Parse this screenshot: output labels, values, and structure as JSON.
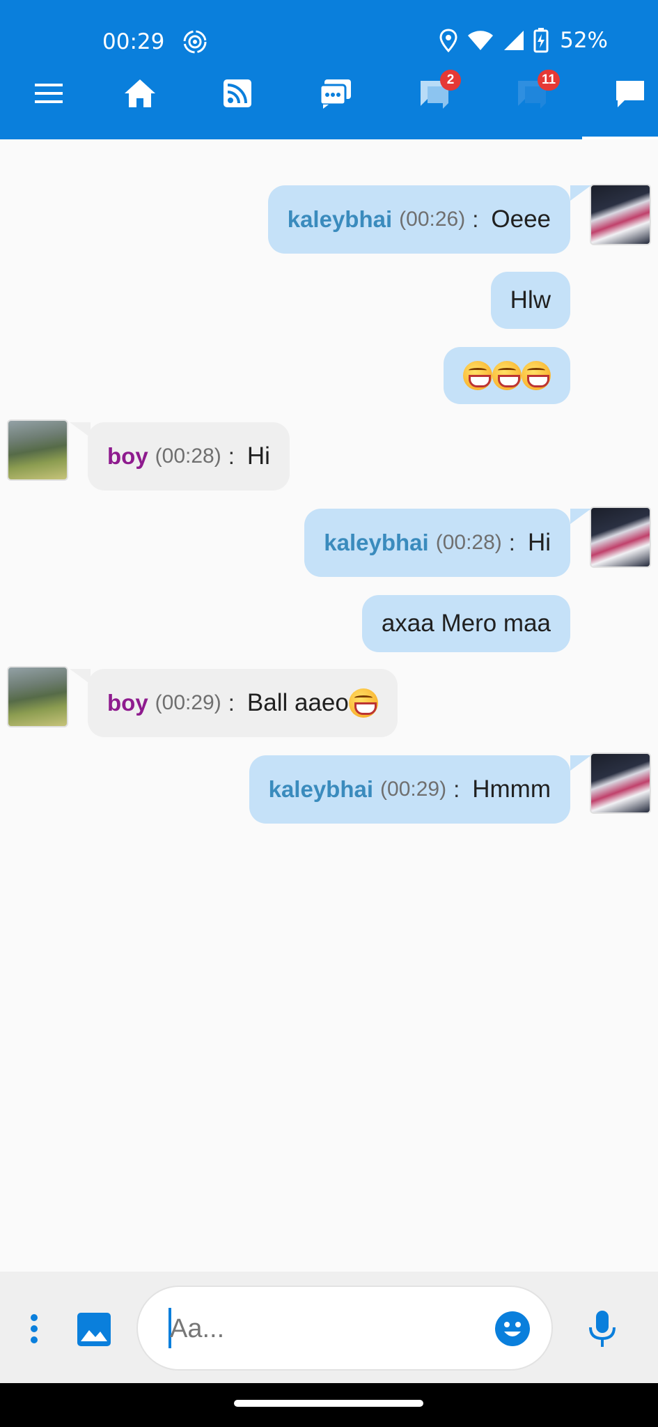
{
  "status_bar": {
    "time": "00:29",
    "battery": "52%"
  },
  "nav": {
    "items": [
      {
        "name": "menu",
        "icon": "menu-icon"
      },
      {
        "name": "home",
        "icon": "home-icon"
      },
      {
        "name": "feed",
        "icon": "rss-icon"
      },
      {
        "name": "messages",
        "icon": "messages-icon"
      },
      {
        "name": "private-chats",
        "icon": "chat-bubbles-icon",
        "badge": "2"
      },
      {
        "name": "rooms",
        "icon": "chat-bubbles-icon",
        "badge": "11"
      },
      {
        "name": "chat",
        "icon": "chat-icon",
        "active": true
      }
    ],
    "accent": "#0a7fdc",
    "badge_color": "#e53935"
  },
  "messages": [
    {
      "from": "mine",
      "nick": "kaleybhai",
      "time": "(00:26)",
      "sep": ":",
      "text": "Oeee"
    },
    {
      "from": "mine",
      "text": "Hlw"
    },
    {
      "from": "mine",
      "emoji": "grinning-squint-face x3"
    },
    {
      "from": "theirs",
      "nick": "boy",
      "time": "(00:28)",
      "sep": ":",
      "text": "Hi"
    },
    {
      "from": "mine",
      "nick": "kaleybhai",
      "time": "(00:28)",
      "sep": ":",
      "text": "Hi"
    },
    {
      "from": "mine",
      "text": "axaa Mero maa"
    },
    {
      "from": "theirs",
      "nick": "boy",
      "time": "(00:29)",
      "sep": ":",
      "text": "Ball aaeo",
      "emoji": "grinning-squint-face"
    },
    {
      "from": "mine",
      "nick": "kaleybhai",
      "time": "(00:29)",
      "sep": ":",
      "text": "Hmmm"
    }
  ],
  "colors": {
    "mine_bubble": "#c5e1f8",
    "theirs_bubble": "#efefef",
    "mine_nick": "#3a8bbd",
    "theirs_nick": "#8e1b8e"
  },
  "composer": {
    "placeholder": "Aa..."
  }
}
